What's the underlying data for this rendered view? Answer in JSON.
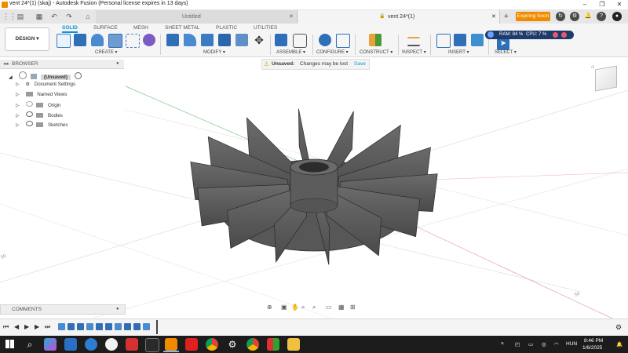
{
  "window": {
    "title": "vent 24*(1) (skaj) - Autodesk Fusion (Personal license expires in 13 days)",
    "minimize": "–",
    "maximize": "❐",
    "close": "✕"
  },
  "tabs": [
    {
      "label": "Untitled",
      "active": false
    },
    {
      "label": "vent 24*(1)",
      "active": true
    }
  ],
  "header": {
    "expiring": "Expiring Soon"
  },
  "workspace": {
    "label": "DESIGN ▾"
  },
  "ribbon_tabs": [
    "SOLID",
    "SURFACE",
    "MESH",
    "SHEET METAL",
    "PLASTIC",
    "UTILITIES"
  ],
  "ribbon_groups": [
    "CREATE ▾",
    "MODIFY ▾",
    "ASSEMBLE ▾",
    "CONFIGURE ▾",
    "CONSTRUCT ▾",
    "INSPECT ▾",
    "INSERT ▾",
    "SELECT ▾"
  ],
  "perf": {
    "ram": "RAM: 84 %",
    "cpu": "CPU: 7 %"
  },
  "browser": {
    "title": "BROWSER",
    "root": "(Unsaved)",
    "items": [
      "Document Settings",
      "Named Views",
      "Origin",
      "Bodies",
      "Sketches"
    ]
  },
  "unsaved_bar": {
    "label": "Unsaved:",
    "message": "Changes may be lost",
    "save": "Save"
  },
  "comments": {
    "title": "COMMENTS"
  },
  "axis_labels": {
    "left": "50",
    "right": "50"
  },
  "taskbar": {
    "lang": "HUN",
    "time": "8:46 PM",
    "date": "1/6/2025"
  },
  "colors": {
    "accent": "#0696d7",
    "expire": "#f08b00",
    "part": "#5a5a5a"
  }
}
